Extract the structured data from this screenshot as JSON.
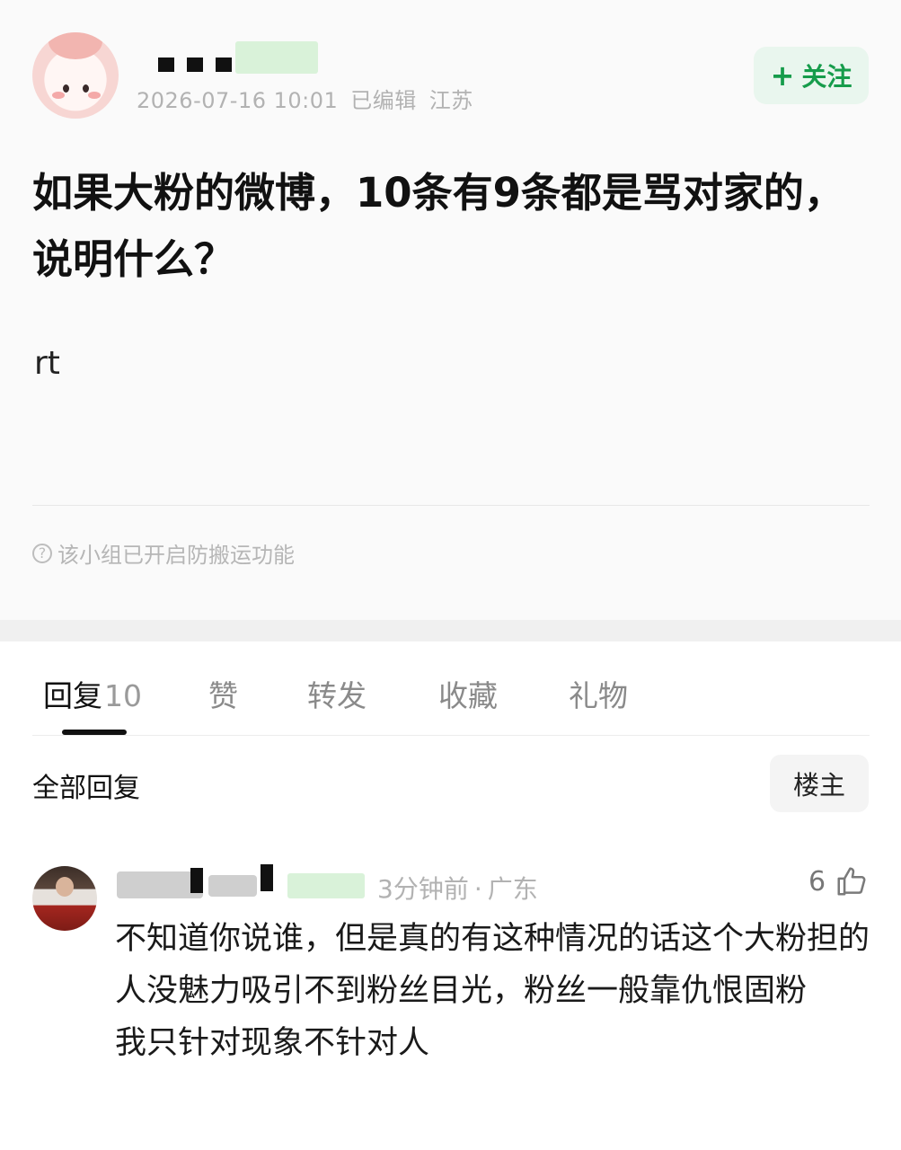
{
  "post": {
    "author": {
      "timestamp": "2026-07-16 10:01",
      "edited": "已编辑",
      "location": "江苏"
    },
    "follow_button": {
      "icon": "plus-icon",
      "label": "关注",
      "color": "#169c4b"
    },
    "title": "如果大粉的微博，10条有9条都是骂对家的，说明什么？",
    "body": "rt",
    "notice": {
      "icon": "question-circle-icon",
      "text": "该小组已开启防搬运功能"
    }
  },
  "tabs": [
    {
      "label": "回复",
      "count": "10",
      "active": true
    },
    {
      "label": "赞"
    },
    {
      "label": "转发"
    },
    {
      "label": "收藏"
    },
    {
      "label": "礼物"
    }
  ],
  "replies": {
    "filter_label": "全部回复",
    "op_filter_label": "楼主",
    "items": [
      {
        "time": "3分钟前",
        "location": "广东",
        "likes": "6",
        "like_icon": "thumbs-up-icon",
        "text": "不知道你说谁，但是真的有这种情况的话这个大粉担的人没魅力吸引不到粉丝目光，粉丝一般靠仇恨固粉\n我只针对现象不针对人"
      }
    ]
  },
  "colors": {
    "accent_green": "#169c4b",
    "follow_bg": "#e9f6ee",
    "meta_gray": "#b2b2b2"
  }
}
